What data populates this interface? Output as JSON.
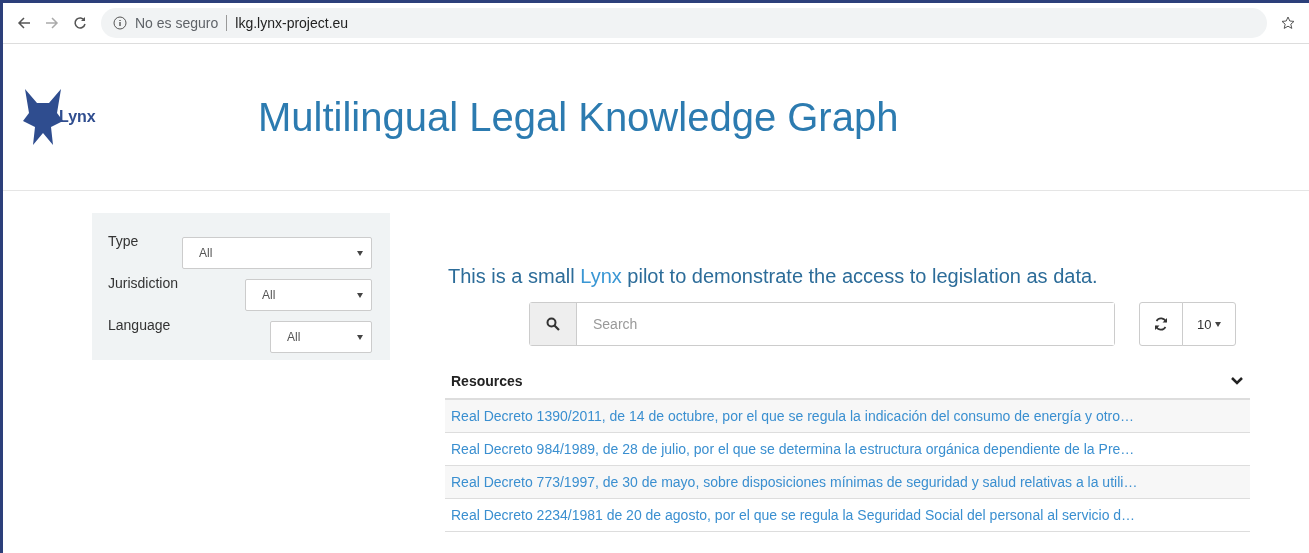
{
  "browser": {
    "security": "No es seguro",
    "url": "lkg.lynx-project.eu",
    "starred": false
  },
  "header": {
    "logo_text": "Lynx",
    "title": "Multilingual Legal Knowledge Graph"
  },
  "filters": [
    {
      "label": "Type",
      "value": "All"
    },
    {
      "label": "Jurisdiction",
      "value": "All"
    },
    {
      "label": "Language",
      "value": "All"
    }
  ],
  "tagline": {
    "before": "This is a small",
    "link": "Lynx",
    "after": "pilot to demonstrate the access to legislation as data."
  },
  "search": {
    "placeholder": "Search"
  },
  "page_size": "10",
  "table": {
    "column": "Resources",
    "expanded": true,
    "rows": [
      "Real Decreto 1390/2011, de 14 de octubre, por el que se regula la indicación del consumo de energía y otro…",
      "Real Decreto 984/1989, de 28 de julio, por el que se determina la estructura orgánica dependiente de la Pre…",
      "Real Decreto 773/1997, de 30 de mayo, sobre disposiciones mínimas de seguridad y salud relativas a la utili…",
      "Real Decreto 2234/1981 de 20 de agosto, por el que se regula la Seguridad Social del personal al servicio d…"
    ]
  }
}
